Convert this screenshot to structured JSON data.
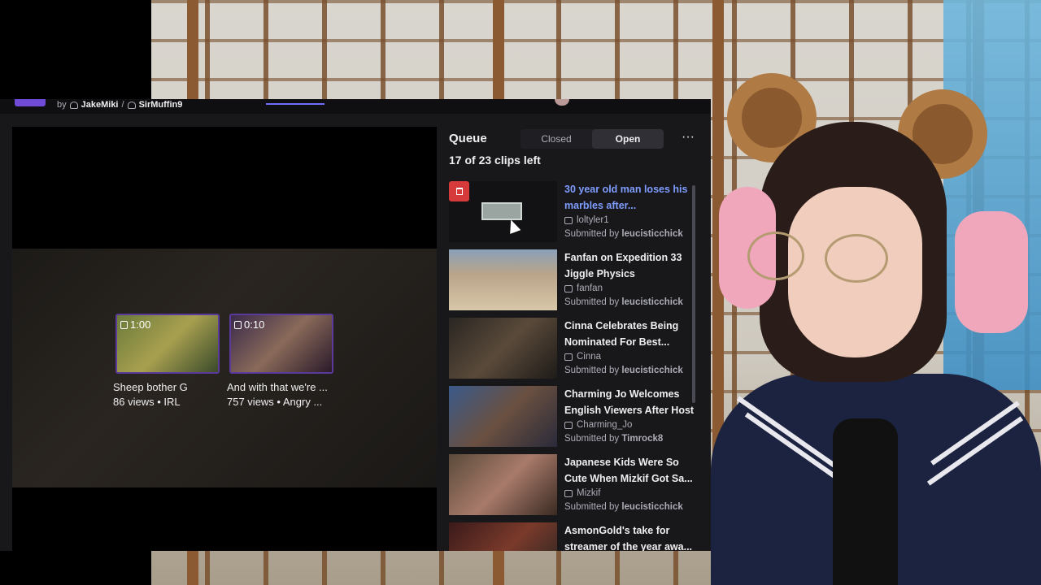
{
  "header": {
    "by_label": "by",
    "creators": [
      "JakeMiki",
      "SirMuffin9"
    ],
    "separator": "/"
  },
  "recommended": [
    {
      "duration": "1:00",
      "title": "Sheep bother G",
      "meta": "86 views • IRL"
    },
    {
      "duration": "0:10",
      "title": "And with that we're ...",
      "meta": "757 views • Angry ..."
    }
  ],
  "queue": {
    "title": "Queue",
    "tabs": {
      "closed": "Closed",
      "open": "Open"
    },
    "more_label": "···",
    "remaining": "17 of 23 clips left",
    "items": [
      {
        "title": "30 year old man loses his marbles after...",
        "channel": "loltyler1",
        "submitted_prefix": "Submitted by",
        "submitter": "leucisticchick",
        "active": true
      },
      {
        "title": "Fanfan on Expedition 33 Jiggle Physics",
        "channel": "fanfan",
        "submitted_prefix": "Submitted by",
        "submitter": "leucisticchick"
      },
      {
        "title": "Cinna Celebrates Being Nominated For Best...",
        "channel": "Cinna",
        "submitted_prefix": "Submitted by",
        "submitter": "leucisticchick"
      },
      {
        "title": "Charming Jo Welcomes English Viewers After Host",
        "channel": "Charming_Jo",
        "submitted_prefix": "Submitted by",
        "submitter": "Timrock8"
      },
      {
        "title": "Japanese Kids Were So Cute When Mizkif Got Sa...",
        "channel": "Mizkif",
        "submitted_prefix": "Submitted by",
        "submitter": "leucisticchick"
      },
      {
        "title": "AsmonGold's take for streamer of the year awa...",
        "channel": "",
        "submitted_prefix": "",
        "submitter": ""
      }
    ]
  },
  "colors": {
    "accent": "#7f9cff",
    "danger": "#d63a3a",
    "panel": "#18181b"
  }
}
